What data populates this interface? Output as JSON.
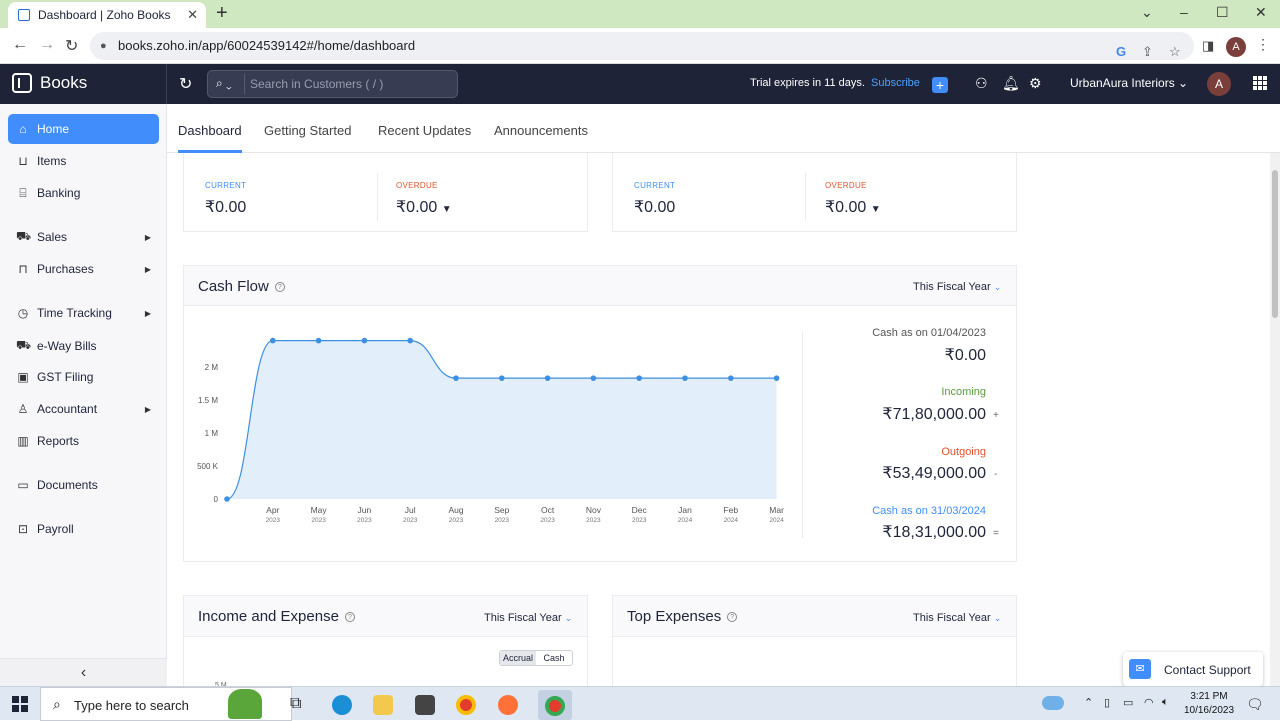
{
  "browser": {
    "tab_title": "Dashboard | Zoho Books",
    "url": "books.zoho.in/app/60024539142#/home/dashboard",
    "profile_initial": "A"
  },
  "header": {
    "brand": "Books",
    "search_placeholder": "Search in Customers ( / )",
    "trial_text": "Trial expires in 11 days.",
    "subscribe_label": "Subscribe",
    "org_name": "UrbanAura Interiors",
    "avatar_initial": "A"
  },
  "sidebar": {
    "items": [
      {
        "label": "Home",
        "icon": "home-icon"
      },
      {
        "label": "Items",
        "icon": "basket-icon"
      },
      {
        "label": "Banking",
        "icon": "bank-icon"
      },
      {
        "label": "Sales",
        "icon": "cart-icon"
      },
      {
        "label": "Purchases",
        "icon": "bag-icon"
      },
      {
        "label": "Time Tracking",
        "icon": "clock-icon"
      },
      {
        "label": "e-Way Bills",
        "icon": "truck-icon"
      },
      {
        "label": "GST Filing",
        "icon": "file-icon"
      },
      {
        "label": "Accountant",
        "icon": "person-icon"
      },
      {
        "label": "Reports",
        "icon": "bar-chart-icon"
      },
      {
        "label": "Documents",
        "icon": "folder-icon"
      },
      {
        "label": "Payroll",
        "icon": "payroll-icon"
      }
    ]
  },
  "tabs": [
    "Dashboard",
    "Getting Started",
    "Recent Updates",
    "Announcements"
  ],
  "receivables": {
    "current_label": "CURRENT",
    "current_value": "₹0.00",
    "overdue_label": "OVERDUE",
    "overdue_value": "₹0.00"
  },
  "payables": {
    "current_label": "CURRENT",
    "current_value": "₹0.00",
    "overdue_label": "OVERDUE",
    "overdue_value": "₹0.00"
  },
  "cash_flow": {
    "title": "Cash Flow",
    "period": "This Fiscal Year",
    "opening_label": "Cash as on 01/04/2023",
    "opening_value": "₹0.00",
    "incoming_label": "Incoming",
    "incoming_value": "₹71,80,000.00",
    "incoming_sign": "+",
    "outgoing_label": "Outgoing",
    "outgoing_value": "₹53,49,000.00",
    "outgoing_sign": "-",
    "closing_label": "Cash as on 31/03/2024",
    "closing_value": "₹18,31,000.00",
    "closing_sign": "=",
    "colors": {
      "line": "#3d8fe0",
      "fill": "#e3eefb",
      "incoming": "#5a9a3b",
      "outgoing": "#e2542e",
      "closing": "#408dfb"
    }
  },
  "income_expense": {
    "title": "Income and Expense",
    "period": "This Fiscal Year",
    "accrual": "Accrual",
    "cash": "Cash",
    "partial_tick": "5 M"
  },
  "top_expenses": {
    "title": "Top Expenses",
    "period": "This Fiscal Year"
  },
  "support": {
    "label": "Contact Support"
  },
  "taskbar": {
    "search_text": "Type here to search",
    "time": "3:21 PM",
    "date": "10/16/2023"
  },
  "chart_data": {
    "type": "area",
    "x": [
      "Apr 2023",
      "May 2023",
      "Jun 2023",
      "Jul 2023",
      "Aug 2023",
      "Sep 2023",
      "Oct 2023",
      "Nov 2023",
      "Dec 2023",
      "Jan 2024",
      "Feb 2024",
      "Mar 2024"
    ],
    "x_labels": [
      [
        "Apr",
        "2023"
      ],
      [
        "May",
        "2023"
      ],
      [
        "Jun",
        "2023"
      ],
      [
        "Jul",
        "2023"
      ],
      [
        "Aug",
        "2023"
      ],
      [
        "Sep",
        "2023"
      ],
      [
        "Oct",
        "2023"
      ],
      [
        "Nov",
        "2023"
      ],
      [
        "Dec",
        "2023"
      ],
      [
        "Jan",
        "2024"
      ],
      [
        "Feb",
        "2024"
      ],
      [
        "Mar",
        "2024"
      ]
    ],
    "start_value": 0,
    "values": [
      2400000,
      2400000,
      2400000,
      2400000,
      1831000,
      1831000,
      1831000,
      1831000,
      1831000,
      1831000,
      1831000,
      1831000
    ],
    "yticks": [
      0,
      500000,
      1000000,
      1500000,
      2000000
    ],
    "ytick_labels": [
      "0",
      "500 K",
      "1 M",
      "1.5 M",
      "2 M"
    ],
    "ylim": [
      0,
      2500000
    ],
    "grid": false
  }
}
